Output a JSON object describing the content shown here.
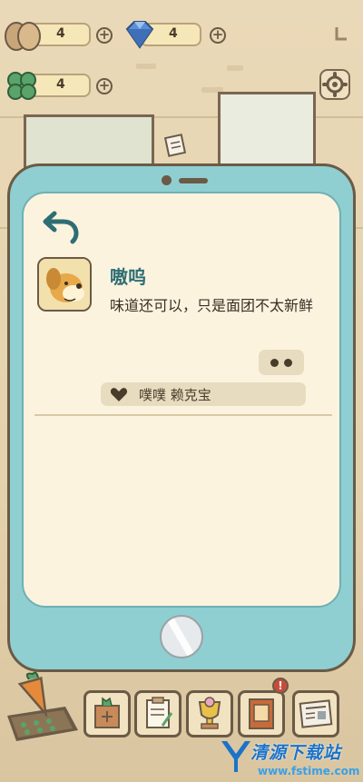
{
  "resources": {
    "eggs": {
      "value": "4",
      "icon": "egg-icon"
    },
    "gems": {
      "value": "4",
      "icon": "gem-icon"
    },
    "clover": {
      "value": "4",
      "icon": "clover-icon"
    }
  },
  "plus_label": "+",
  "message": {
    "sender_name": "嗷呜",
    "text": "味道还可以，只是面团不太新鲜",
    "likes": "噗噗 赖克宝"
  },
  "bottom_bar": {
    "notification_badge": "!",
    "items": [
      "carrot-field",
      "shop-cabinet",
      "recipe-clipboard",
      "trophy",
      "book",
      "newspaper"
    ]
  },
  "watermark": {
    "title": "清源下载站",
    "url": "www.fstime.com"
  },
  "colors": {
    "phone_body": "#8fcfd1",
    "screen": "#fcf3df",
    "name_text": "#2d6e74",
    "badge": "#c84b3b"
  }
}
